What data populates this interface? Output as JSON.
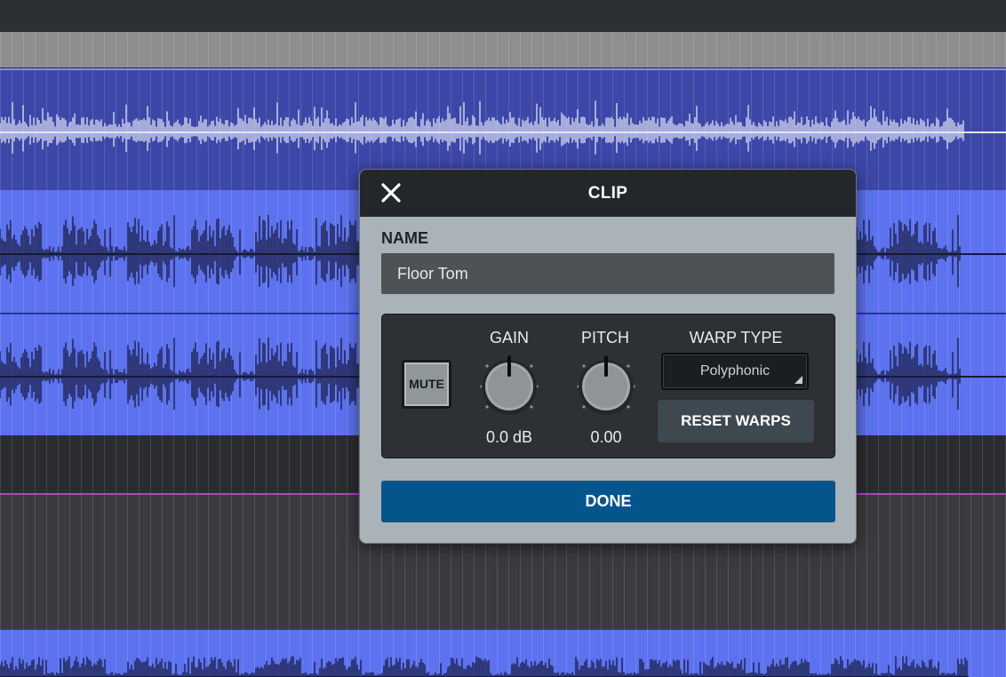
{
  "dialog": {
    "title": "CLIP",
    "close_icon": "close-icon",
    "name_label": "NAME",
    "name_value": "Floor Tom",
    "mute_label": "MUTE",
    "gain_label": "GAIN",
    "gain_value": "0.0 dB",
    "pitch_label": "PITCH",
    "pitch_value": "0.00",
    "warp_label": "WARP TYPE",
    "warp_value": "Polyphonic",
    "reset_label": "RESET WARPS",
    "done_label": "DONE"
  },
  "colors": {
    "selected_track": "#3d47a8",
    "track": "#5c72ef",
    "done_button": "#05558d",
    "automation_line": "#b940c6",
    "dialog_background": "#aab4b8",
    "dialog_header": "#23272b"
  }
}
